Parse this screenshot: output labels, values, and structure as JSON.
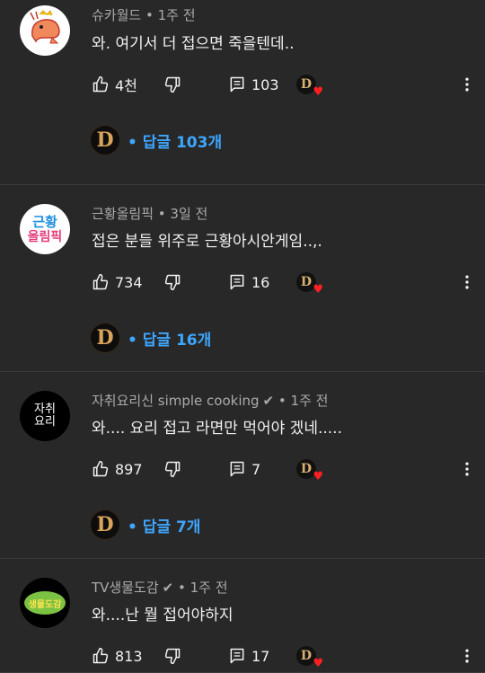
{
  "comments": [
    {
      "author": "슈카월드",
      "time": "• 1주 전",
      "verified": false,
      "text": "와. 여기서 더 접으면 죽을텐데..",
      "likes": "4천",
      "reply_count": "103",
      "replies_label": "• 답글 103개",
      "avatar_icon": "shrimp-icon"
    },
    {
      "author": "근황올림픽",
      "time": "• 3일 전",
      "verified": false,
      "text": "접은 분들 위주로 근황아시안게임..,.",
      "likes": "734",
      "reply_count": "16",
      "replies_label": "• 답글 16개",
      "avatar_icon": "olympic-logo-icon",
      "avatar_text_top": "근황",
      "avatar_text_bottom": "올림픽"
    },
    {
      "author": "자취요리신 simple cooking",
      "time": "• 1주 전",
      "verified": true,
      "text": "와.... 요리 접고 라면만 먹어야 겠네.....",
      "likes": "897",
      "reply_count": "7",
      "replies_label": "• 답글 7개",
      "avatar_icon": "cooking-logo-icon",
      "avatar_text_top": "자취",
      "avatar_text_bottom": "요리"
    },
    {
      "author": "TV생물도감",
      "time": "• 1주 전",
      "verified": true,
      "text": "와....난 뭘 접어야하지",
      "likes": "813",
      "reply_count": "17",
      "avatar_icon": "bio-logo-icon",
      "avatar_text": "생물도감"
    }
  ],
  "creator_badge_letter": "D",
  "colors": {
    "background": "#282828",
    "link": "#3ea6ff",
    "heart": "#ff2020"
  }
}
